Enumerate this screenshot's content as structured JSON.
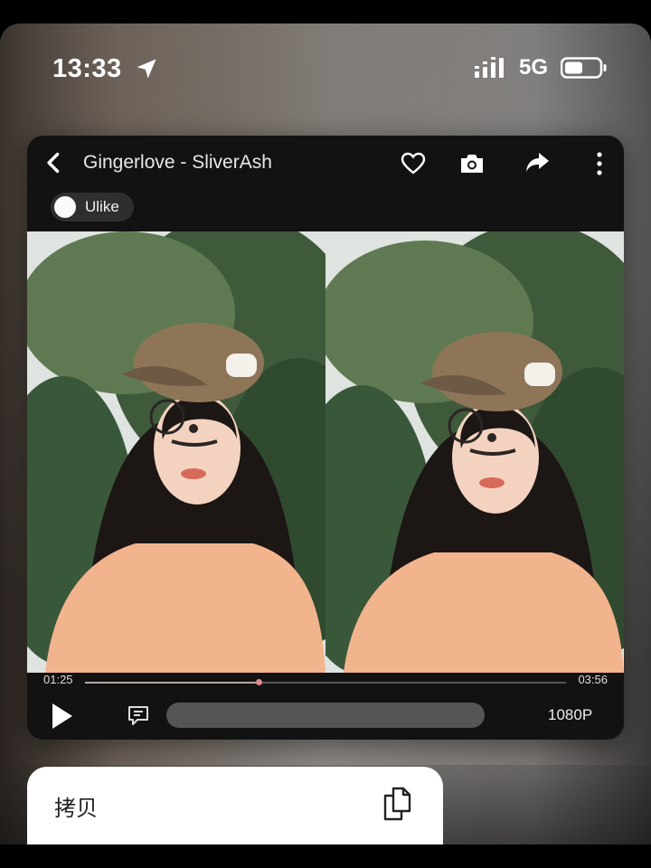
{
  "status_bar": {
    "time": "13:33",
    "network": "5G"
  },
  "player": {
    "title": "Gingerlove - SliverAsh",
    "user": "Ulike",
    "current_time": "01:25",
    "total_time": "03:56",
    "progress_fraction": 0.36,
    "quality": "1080P"
  },
  "context_menu": {
    "copy_label": "拷贝"
  },
  "icons": [
    "location-arrow-icon",
    "signal-icon",
    "battery-icon",
    "back-icon",
    "heart-icon",
    "camera-icon",
    "share-icon",
    "more-icon",
    "play-icon",
    "danmaku-icon",
    "copy-icon"
  ]
}
